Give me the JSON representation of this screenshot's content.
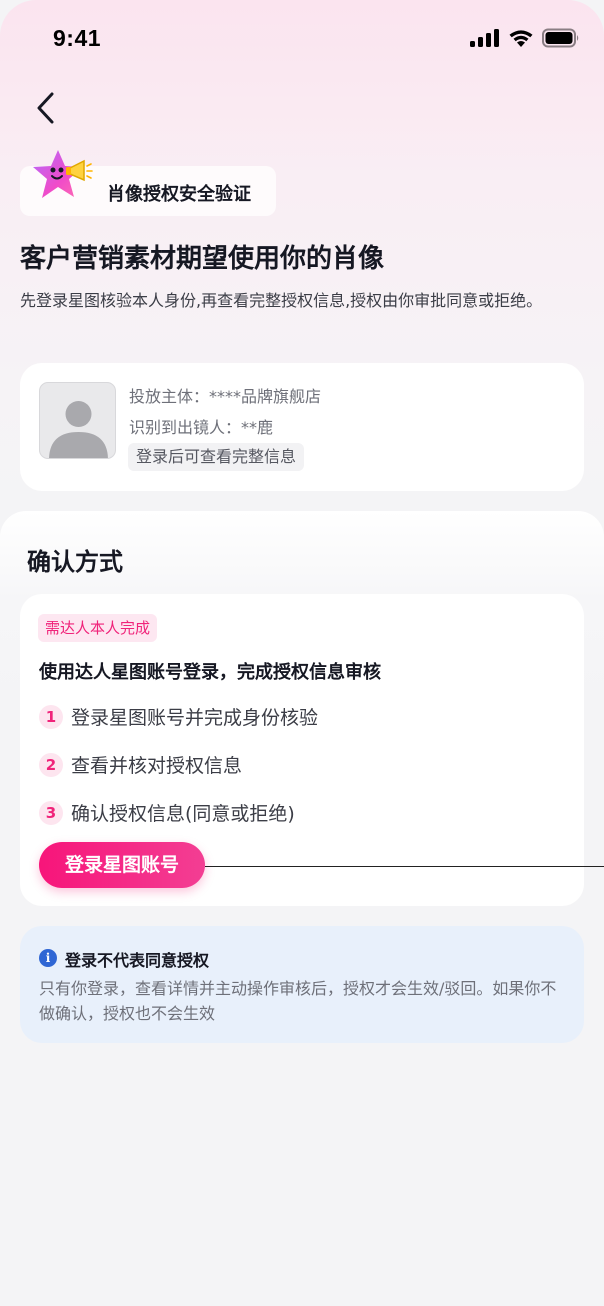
{
  "status_bar": {
    "time": "9:41",
    "icons": [
      "signal-icon",
      "wifi-icon",
      "battery-icon"
    ]
  },
  "header": {
    "back_icon": "chevron-left-icon",
    "chip_icon": "star-megaphone-icon",
    "chip_label": "肖像授权安全验证",
    "headline": "客户营销素材期望使用你的肖像",
    "subtitle": "先登录星图核验本人身份,再查看完整授权信息,授权由你审批同意或拒绝。"
  },
  "info_card": {
    "avatar_icon": "avatar-placeholder-icon",
    "advertiser": "投放主体：****品牌旗舰店",
    "detected_person": "识别到出镜人：**鹿",
    "login_hint": "登录后可查看完整信息"
  },
  "confirm": {
    "section_title": "确认方式",
    "requirement_tag": "需达人本人完成",
    "method_title": "使用达人星图账号登录，完成授权信息审核",
    "steps": [
      {
        "num": "1",
        "text": "登录星图账号并完成身份核验"
      },
      {
        "num": "2",
        "text": "查看并核对授权信息"
      },
      {
        "num": "3",
        "text": "确认授权信息(同意或拒绝)"
      }
    ],
    "login_button": "登录星图账号"
  },
  "notice": {
    "icon": "info-icon",
    "icon_glyph": "i",
    "title": "登录不代表同意授权",
    "body": "只有你登录，查看详情并主动操作审核后，授权才会生效/驳回。如果你不做确认，授权也不会生效"
  },
  "colors": {
    "accent": "#f0237a",
    "notice_bg": "#e8f0fb",
    "info_blue": "#2f66d4"
  }
}
